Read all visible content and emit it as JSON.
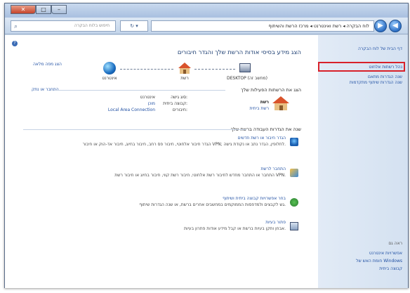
{
  "window": {
    "close_glyph": "✕",
    "max_glyph": "□",
    "min_glyph": "–"
  },
  "toolbar": {
    "search_placeholder": "חיפוש בלוח הבקרה",
    "refresh_glyph": "↻ ▾",
    "address": "לוח הבקרה ◂ רשת ואינטרנט ◂ מרכז הרשת והשיתוף",
    "back_glyph": "◀",
    "forward_glyph": "▶"
  },
  "left_pane": {
    "home": "דף הבית של לוח הבקרה",
    "manage_wireless": "נהל רשתות אלחוט",
    "change_adapter": "שנה הגדרות מתאם",
    "change_sharing": "שנה הגדרות שיתוף מתקדמות",
    "see_also": "ראה גם",
    "internet_options": "אפשרויות אינטרנט",
    "firewall": "חומת האש של Windows",
    "homegroup": "קבוצה ביתית"
  },
  "main": {
    "help_glyph": "?",
    "title": "הצג מידע בסיסי אודות הרשת שלך והגדר חיבורים",
    "full_map": "הצג מפה מלאה",
    "map": {
      "computer_label": "DESKTOP (מחשב זה)",
      "network_label": "רשת",
      "internet_label": "אינטרנט"
    },
    "active_header": "הצג את הרשתות הפעילות שלך",
    "connect_disconnect": "התחבר או נתק",
    "network_name": "רשת",
    "network_type": "רשת ביתית",
    "access_type_label": "סוג גישה:",
    "access_type_value": "אינטרנט",
    "homegroup_label": "קבוצה ביתית:",
    "homegroup_value": "מוכן",
    "connections_label": "חיבורים:",
    "connections_value": "Local Area Connection",
    "change_header": "שנה את הגדרות העבודה ברשת שלך",
    "tasks": [
      {
        "title": "הגדר חיבור או רשת חדשים",
        "desc": "הגדר חיבור אלחוטי, חיבור פס רחב, חיבור בחיוג, חיבור אד-הוק או חיבור VPN; לחלופין, הגדר נתב או נקודת גישה."
      },
      {
        "title": "התחבר לרשת",
        "desc": "התחבר או התחבר מחדש לחיבור רשת אלחוטי, חיבור רשת קווי, חיבור בחיוג או חיבור רשת VPN."
      },
      {
        "title": "בחר אפשרויות קבוצה ביתית ושיתוף",
        "desc": "גש לקבצים ולמדפסות הממוקמים במחשבים אחרים ברשת, או שנה הגדרות שיתוף."
      },
      {
        "title": "פתור בעיות",
        "desc": "אבחן ותקן בעיות ברשת או קבל מידע אודות פתרון בעיות."
      }
    ]
  }
}
